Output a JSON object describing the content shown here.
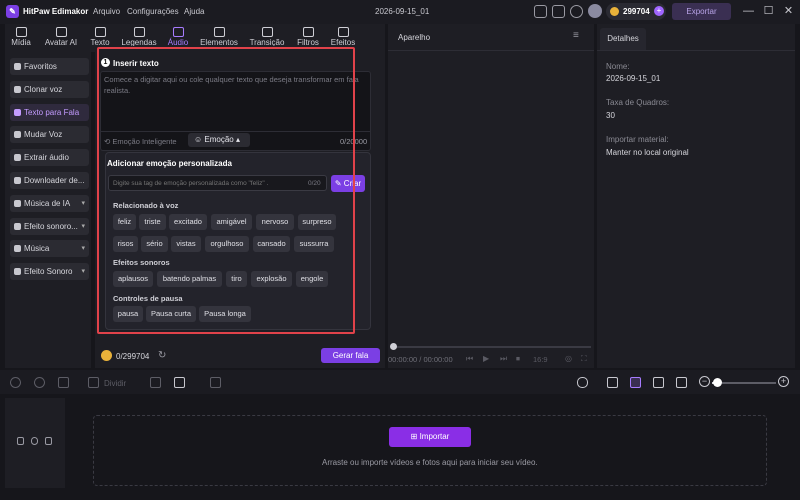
{
  "app": {
    "name": "HitPaw Edimakor",
    "menu": [
      "Arquivo",
      "Configurações",
      "Ajuda"
    ],
    "doc_title": "2026-09-15_01",
    "credits": "299704",
    "export_label": "Exportar"
  },
  "tabs": [
    {
      "label": "Mídia",
      "icon": "media-icon"
    },
    {
      "label": "Avatar AI",
      "icon": "avatar-ai-icon"
    },
    {
      "label": "Texto",
      "icon": "text-icon"
    },
    {
      "label": "Legendas",
      "icon": "subtitles-icon"
    },
    {
      "label": "Áudio",
      "icon": "audio-icon",
      "active": true
    },
    {
      "label": "Elementos",
      "icon": "elements-icon"
    },
    {
      "label": "Transição",
      "icon": "transition-icon"
    },
    {
      "label": "Filtros",
      "icon": "filters-icon"
    },
    {
      "label": "Efeitos",
      "icon": "effects-icon"
    }
  ],
  "sidebar": {
    "items": [
      {
        "label": "Favoritos",
        "icon": "star-icon"
      },
      {
        "label": "Clonar voz",
        "icon": "clone-voice-icon"
      },
      {
        "label": "Texto para Fala",
        "icon": "tts-icon",
        "active": true
      },
      {
        "label": "Mudar Voz",
        "icon": "voice-change-icon"
      },
      {
        "label": "Extrair áudio",
        "icon": "mic-icon"
      },
      {
        "label": "Downloader de...",
        "icon": "download-icon"
      },
      {
        "label": "Música de IA",
        "icon": "ai-music-icon",
        "caret": "▾"
      },
      {
        "label": "Efeito sonoro...",
        "icon": "sound-effect-icon",
        "caret": "▾"
      },
      {
        "label": "Música",
        "icon": "music-icon",
        "caret": "▾"
      },
      {
        "label": "Efeito Sonoro",
        "icon": "sound-effect-icon",
        "caret": "▾"
      }
    ]
  },
  "tts": {
    "step": "1",
    "section_title": "Inserir texto",
    "placeholder": "Comece a digitar aqui ou cole qualquer texto que deseja transformar em fala realista.",
    "smart_emotion": "Emoção Inteligente",
    "emotion_label": "Emoção",
    "char_count": "0/20000",
    "credits": "0/299704",
    "generate_label": "Gerar fala"
  },
  "emotion_popup": {
    "title": "Adicionar emoção personalizada",
    "input_placeholder": "Digite sua tag de emoção personalizada como \"feliz\" .",
    "input_count": "0/20",
    "create_label": "Criar",
    "group_voice": "Relacionado à voz",
    "voice_row1": [
      "feliz",
      "triste",
      "excitado",
      "amigável",
      "nervoso",
      "surpreso"
    ],
    "voice_row2": [
      "risos",
      "sério",
      "vistas",
      "orgulhoso",
      "cansado",
      "sussurra"
    ],
    "group_sfx": "Efeitos sonoros",
    "sfx": [
      "aplausos",
      "batendo palmas",
      "tiro",
      "explosão",
      "engole"
    ],
    "group_pause": "Controles de pausa",
    "pause": [
      "pausa",
      "Pausa curta",
      "Pausa longa"
    ]
  },
  "player": {
    "title": "Aparelho",
    "timecode": "00:00:00 / 00:00:00",
    "ratio": "16:9"
  },
  "details": {
    "tab": "Detalhes",
    "name_label": "Nome:",
    "name_value": "2026-09-15_01",
    "fps_label": "Taxa de Quadros:",
    "fps_value": "30",
    "import_label": "Importar material:",
    "import_value": "Manter no local original"
  },
  "timeline": {
    "split_label": "Dividir",
    "import_label": "Importar",
    "drop_text": "Arraste ou importe vídeos e fotos aqui para iniciar seu vídeo."
  },
  "colors": {
    "accent": "#7b3fe4",
    "highlight": "#e0424a"
  }
}
